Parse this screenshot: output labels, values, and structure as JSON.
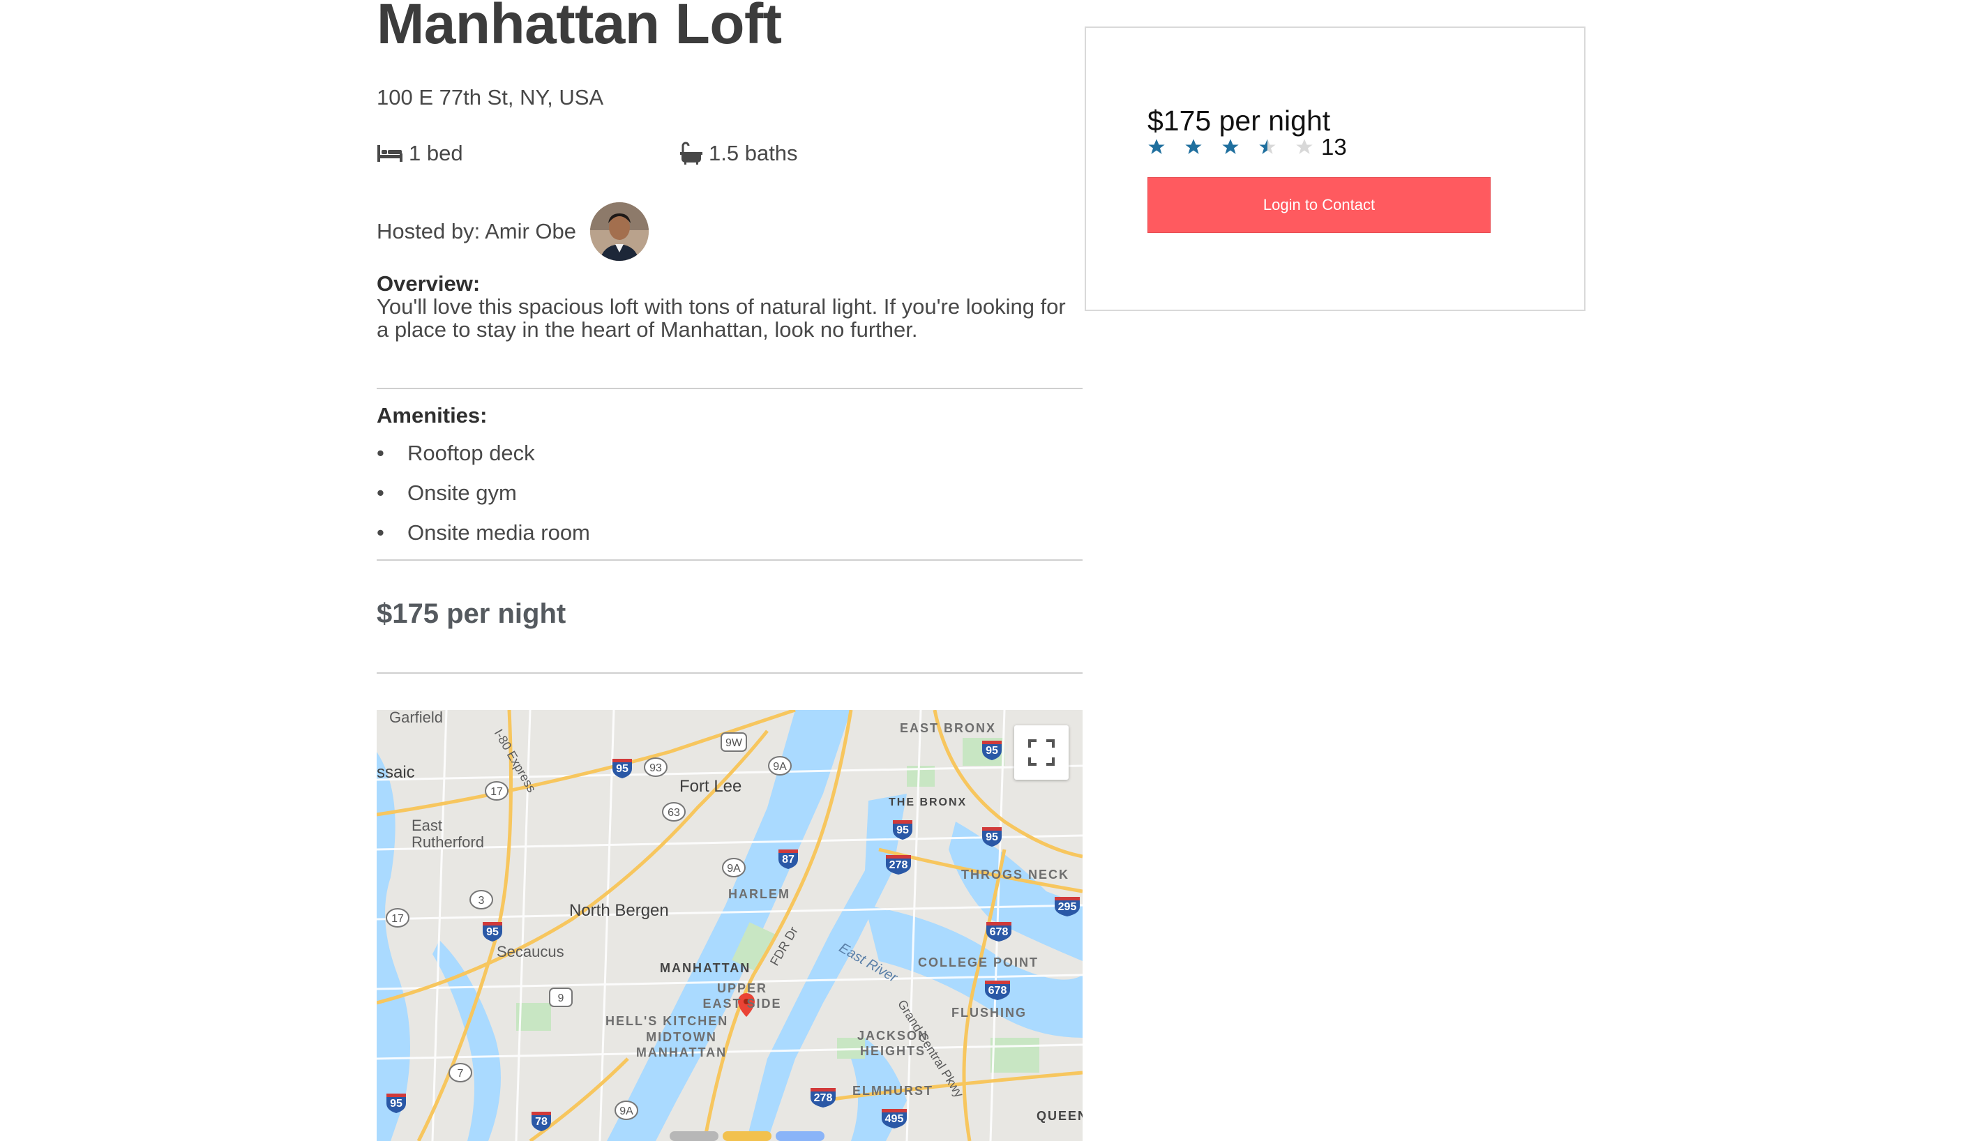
{
  "listing": {
    "title": "Manhattan Loft",
    "address": "100 E 77th St, NY, USA",
    "beds": "1 bed",
    "baths": "1.5 baths",
    "host_label": "Hosted by: Amir Obe",
    "overview_label": "Overview:",
    "overview_text": "You'll love this spacious loft with tons of natural light. If you're looking for a place to stay in the heart of Manhattan, look no further.",
    "amenities_label": "Amenities:",
    "amenities": [
      "Rooftop deck",
      "Onsite gym",
      "Onsite media room"
    ],
    "price_label": "$175 per night"
  },
  "booking_card": {
    "price": "$175 per night",
    "rating": 3.5,
    "rating_max": 5,
    "review_count": "13",
    "contact_button": "Login to Contact"
  },
  "map": {
    "labels": {
      "passaic": "ssaic",
      "garfield": "Garfield",
      "fort_lee": "Fort Lee",
      "east_rutherford": "East Rutherford",
      "north_bergen": "North Bergen",
      "secaucus": "Secaucus",
      "manhattan": "MANHATTAN",
      "harlem": "HARLEM",
      "upper_east_side": "UPPER EAST SIDE",
      "hells_kitchen": "HELL'S KITCHEN",
      "midtown": "MIDTOWN MANHATTAN",
      "east_bronx": "EAST BRONX",
      "the_bronx": "THE BRONX",
      "throgs_neck": "THROGS NECK",
      "college_point": "COLLEGE POINT",
      "flushing": "FLUSHING",
      "jackson_heights": "JACKSON HEIGHTS",
      "elmhurst": "ELMHURST",
      "queens": "QUEEN",
      "east_river": "East River",
      "grand_central": "Grand Central Pkwy",
      "fdr": "FDR Dr",
      "i80": "I-80 Express"
    },
    "colors": {
      "water": "#aadaff",
      "land": "#e8e7e3",
      "park": "#c8e6c3",
      "highway": "#f7c65e",
      "interstate": "#2a58a6",
      "marker": "#ea4335"
    }
  },
  "colors": {
    "accent": "#ff5a5f",
    "star_filled": "#1f6f9e",
    "star_empty": "#d8d8d8"
  }
}
